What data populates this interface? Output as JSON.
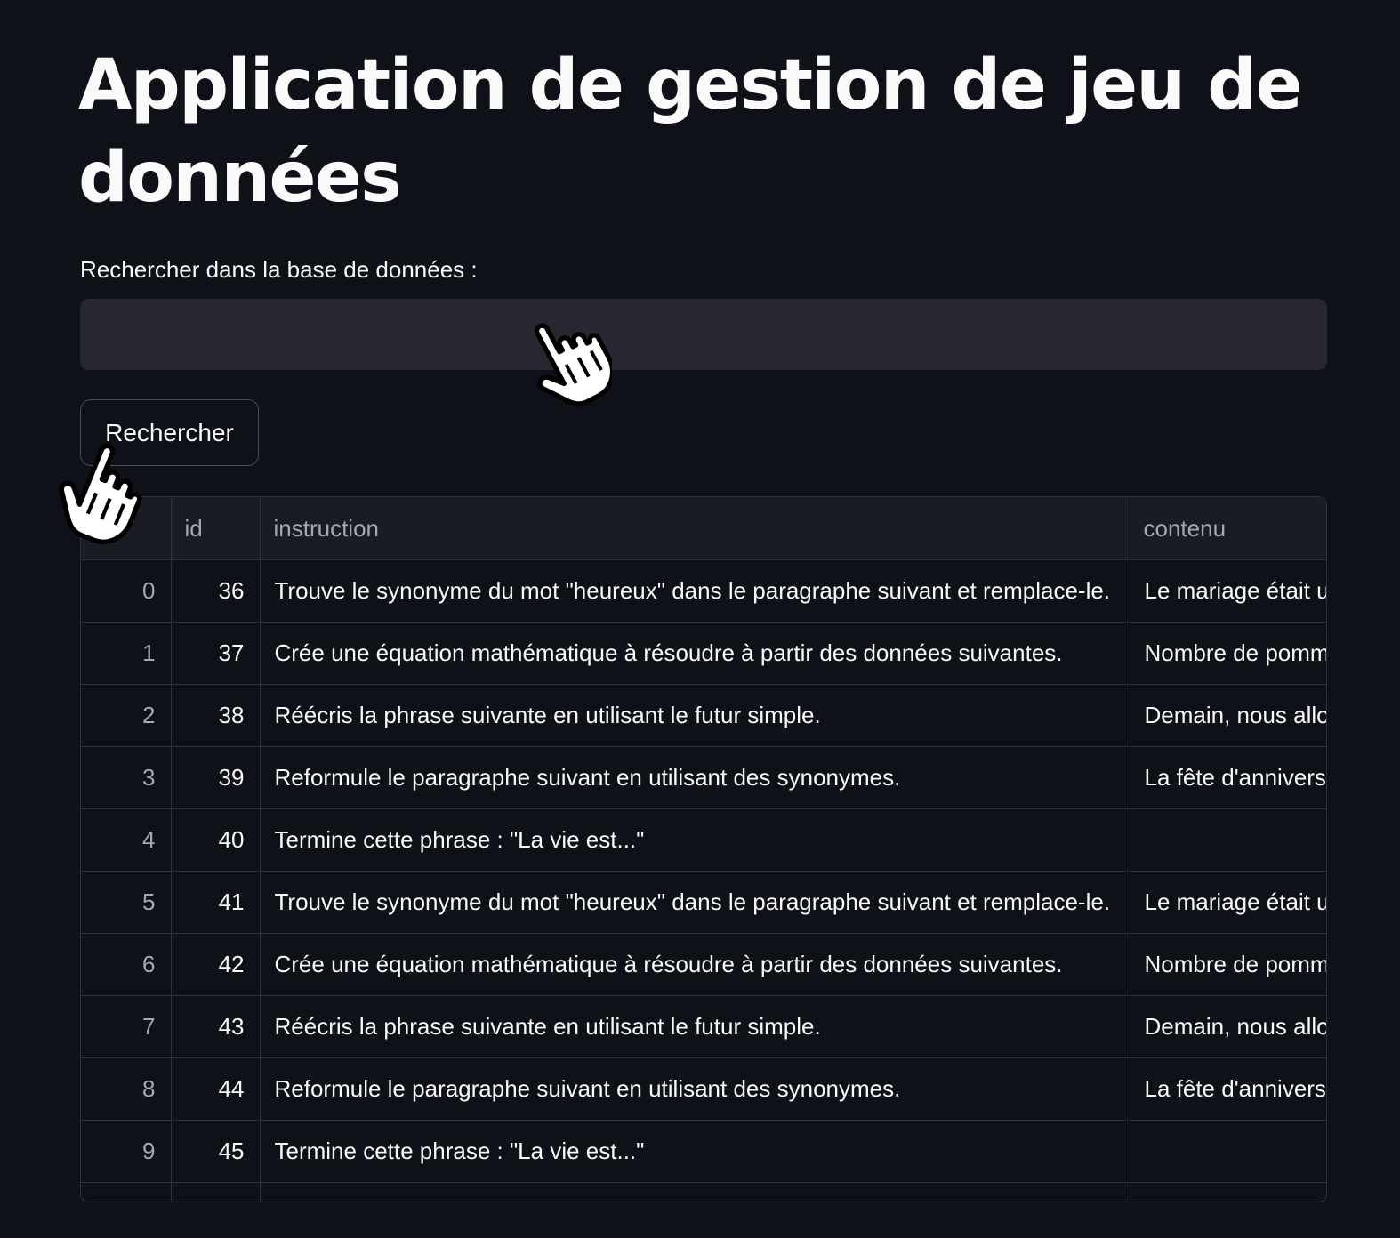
{
  "page": {
    "title": "Application de gestion de jeu de données"
  },
  "search": {
    "label": "Rechercher dans la base de données :",
    "value": "",
    "placeholder": "",
    "button_label": "Rechercher"
  },
  "table": {
    "columns": [
      "",
      "id",
      "instruction",
      "contenu"
    ],
    "rows": [
      {
        "index": "0",
        "id": "36",
        "instruction": "Trouve le synonyme du mot \"heureux\" dans le paragraphe suivant et remplace-le.",
        "contenu": "Le mariage était u"
      },
      {
        "index": "1",
        "id": "37",
        "instruction": "Crée une équation mathématique à résoudre à partir des données suivantes.",
        "contenu": "Nombre de pomm"
      },
      {
        "index": "2",
        "id": "38",
        "instruction": "Réécris la phrase suivante en utilisant le futur simple.",
        "contenu": "Demain, nous allo"
      },
      {
        "index": "3",
        "id": "39",
        "instruction": "Reformule le paragraphe suivant en utilisant des synonymes.",
        "contenu": "La fête d'annivers"
      },
      {
        "index": "4",
        "id": "40",
        "instruction": "Termine cette phrase : \"La vie est...\"",
        "contenu": ""
      },
      {
        "index": "5",
        "id": "41",
        "instruction": "Trouve le synonyme du mot \"heureux\" dans le paragraphe suivant et remplace-le.",
        "contenu": "Le mariage était u"
      },
      {
        "index": "6",
        "id": "42",
        "instruction": "Crée une équation mathématique à résoudre à partir des données suivantes.",
        "contenu": "Nombre de pomm"
      },
      {
        "index": "7",
        "id": "43",
        "instruction": "Réécris la phrase suivante en utilisant le futur simple.",
        "contenu": "Demain, nous allo"
      },
      {
        "index": "8",
        "id": "44",
        "instruction": "Reformule le paragraphe suivant en utilisant des synonymes.",
        "contenu": "La fête d'annivers"
      },
      {
        "index": "9",
        "id": "45",
        "instruction": "Termine cette phrase : \"La vie est...\"",
        "contenu": ""
      },
      {
        "index": "",
        "id": "",
        "instruction": "",
        "contenu": ""
      }
    ]
  },
  "icons": {
    "cursor": "hand-pointer-icon"
  },
  "colors": {
    "background": "#0e1117",
    "input_background": "#262730",
    "table_header": "#1a1c24",
    "border": "#2e3140",
    "text": "#fafafa",
    "muted_text": "#a3a8b8"
  }
}
